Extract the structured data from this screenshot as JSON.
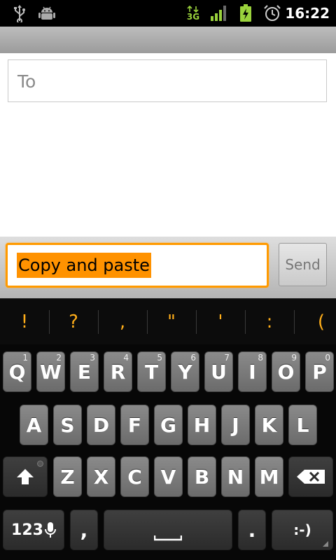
{
  "status_bar": {
    "icons": [
      "usb-icon",
      "android-debug-icon",
      "3g-data-icon",
      "signal-icon",
      "battery-charging-icon",
      "alarm-icon"
    ],
    "network_label": "3G",
    "time": "16:22"
  },
  "compose": {
    "to_placeholder": "To",
    "message_text": "Copy and paste",
    "send_label": "Send"
  },
  "suggestions": [
    "!",
    "?",
    ",",
    "\"",
    "'",
    ":",
    "("
  ],
  "keyboard": {
    "row1": [
      {
        "label": "Q",
        "hint": "1"
      },
      {
        "label": "W",
        "hint": "2"
      },
      {
        "label": "E",
        "hint": "3"
      },
      {
        "label": "R",
        "hint": "4"
      },
      {
        "label": "T",
        "hint": "5"
      },
      {
        "label": "Y",
        "hint": "6"
      },
      {
        "label": "U",
        "hint": "7"
      },
      {
        "label": "I",
        "hint": "8"
      },
      {
        "label": "O",
        "hint": "9"
      },
      {
        "label": "P",
        "hint": "0"
      }
    ],
    "row2": [
      "A",
      "S",
      "D",
      "F",
      "G",
      "H",
      "J",
      "K",
      "L"
    ],
    "row3": [
      "Z",
      "X",
      "C",
      "V",
      "B",
      "N",
      "M"
    ],
    "numbers_label": "123",
    "comma_label": ",",
    "period_label": ".",
    "smiley_label": ":-)"
  },
  "colors": {
    "accent_orange": "#ff9a00",
    "suggestion_text": "#ffae1a",
    "key_gray": "#7a7a7a"
  }
}
